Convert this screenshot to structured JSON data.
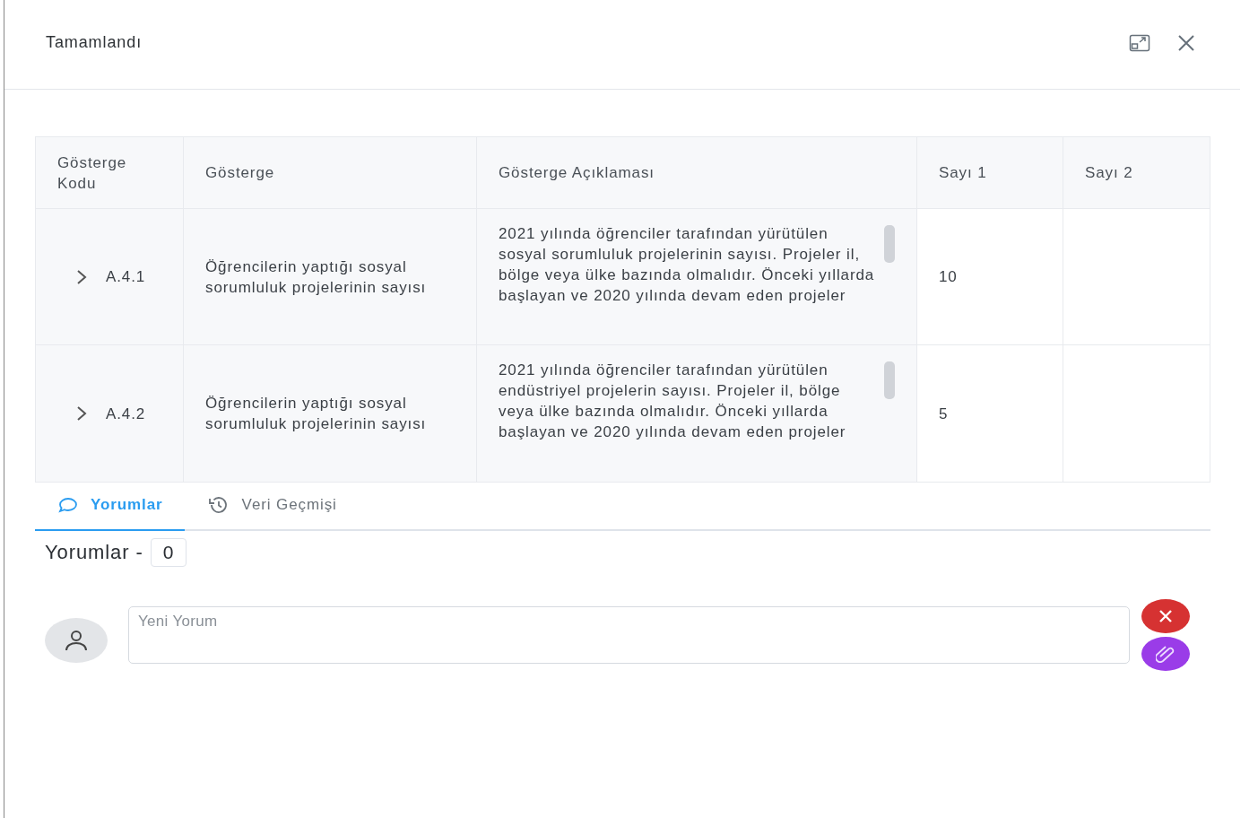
{
  "dialog": {
    "title": "Tamamlandı"
  },
  "table": {
    "columns": [
      "Gösterge Kodu",
      "Gösterge",
      "Gösterge Açıklaması",
      "Sayı 1",
      "Sayı 2"
    ],
    "rows": [
      {
        "code": "A.4.1",
        "expanded": false,
        "indicator": "Öğrencilerin yaptığı sosyal sorumluluk projelerinin sayısı",
        "description": "2021 yılında öğrenciler tarafından yürütülen sosyal sorumluluk projelerinin sayısı. Projeler il, bölge veya ülke bazında olmalıdır. Önceki yıllarda başlayan ve 2020 yılında devam eden projeler",
        "count_1": "10"
      },
      {
        "code": "A.4.2",
        "expanded": false,
        "indicator": "Öğrencilerin yaptığı sosyal sorumluluk projelerinin sayısı",
        "description": "2021 yılında öğrenciler tarafından yürütülen endüstriyel projelerin sayısı. Projeler il, bölge veya ülke bazında olmalıdır. Önceki yıllarda başlayan ve 2020 yılında devam eden projeler",
        "count_1": "5"
      }
    ]
  },
  "tabs": [
    {
      "label": "Yorumlar",
      "kind": "comment",
      "selected": true
    },
    {
      "label": "Veri Geçmişi",
      "kind": "history",
      "selected": false
    }
  ],
  "comments": {
    "heading": "Yorumlar -",
    "count": "0",
    "input": {
      "placeholder": "Yeni Yorum"
    }
  }
}
